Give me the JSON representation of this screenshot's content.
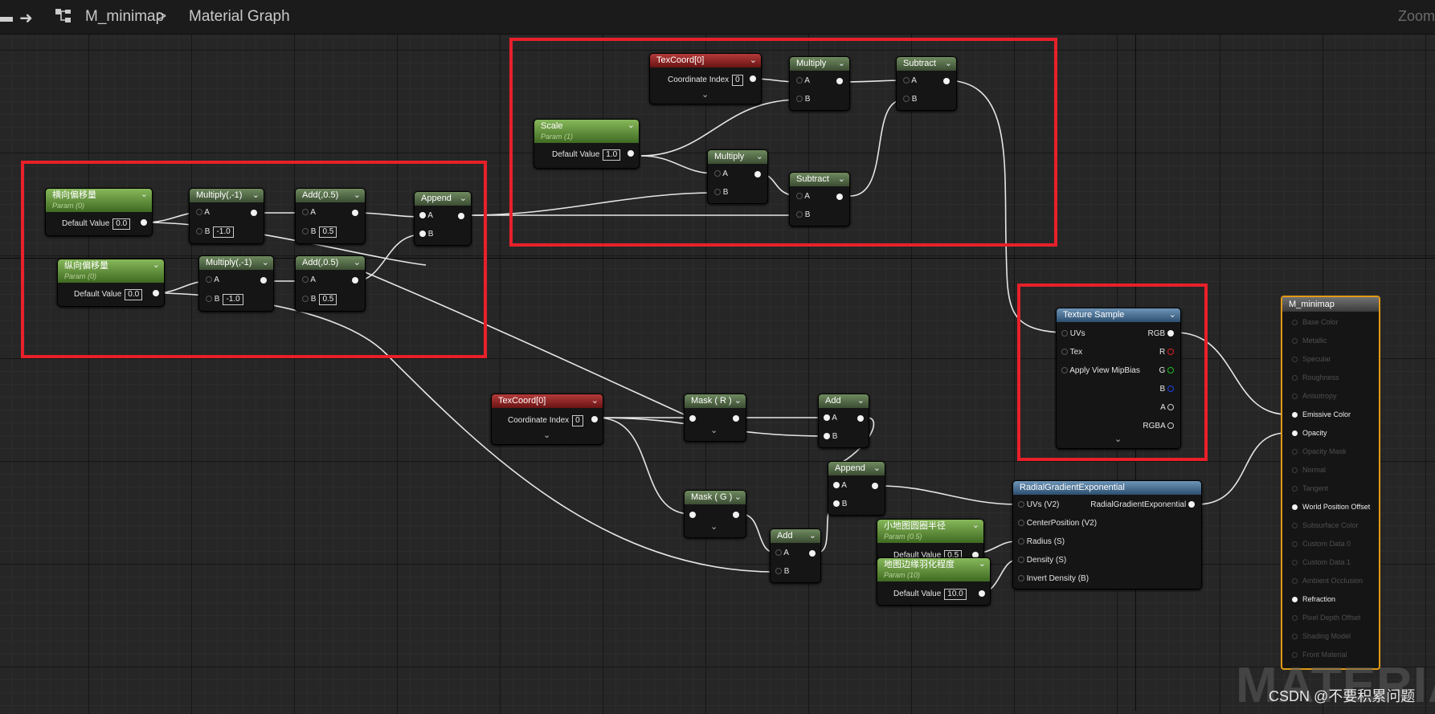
{
  "app": {
    "title": "Material Graph"
  },
  "breadcrumb": {
    "asset": "M_minimap",
    "separator": ">",
    "graph": "Material Graph"
  },
  "toolbar": {
    "zoom_label": "Zoom"
  },
  "nodes": {
    "texcoord_top": {
      "title": "TexCoord[0]",
      "label": "Coordinate Index",
      "value": "0"
    },
    "scale": {
      "title": "Scale",
      "subtitle": "Param (1)",
      "label": "Default Value",
      "value": "1.0"
    },
    "multiply_top1": {
      "title": "Multiply",
      "pin_a": "A",
      "pin_b": "B"
    },
    "multiply_top2": {
      "title": "Multiply",
      "pin_a": "A",
      "pin_b": "B"
    },
    "subtract_top1": {
      "title": "Subtract",
      "pin_a": "A",
      "pin_b": "B"
    },
    "subtract_top2": {
      "title": "Subtract",
      "pin_a": "A",
      "pin_b": "B"
    },
    "param_h": {
      "title": "横向偏移量",
      "subtitle": "Param (0)",
      "label": "Default Value",
      "value": "0.0"
    },
    "param_v": {
      "title": "纵向偏移量",
      "subtitle": "Param (0)",
      "label": "Default Value",
      "value": "0.0"
    },
    "mul_neg1_a": {
      "title": "Multiply(,-1)",
      "pin_a": "A",
      "pin_b": "B",
      "value_b": "-1.0"
    },
    "mul_neg1_b": {
      "title": "Multiply(,-1)",
      "pin_a": "A",
      "pin_b": "B",
      "value_b": "-1.0"
    },
    "add05_a": {
      "title": "Add(,0.5)",
      "pin_a": "A",
      "pin_b": "B",
      "value_b": "0.5"
    },
    "add05_b": {
      "title": "Add(,0.5)",
      "pin_a": "A",
      "pin_b": "B",
      "value_b": "0.5"
    },
    "append_left": {
      "title": "Append",
      "pin_a": "A",
      "pin_b": "B"
    },
    "texcoord_bottom": {
      "title": "TexCoord[0]",
      "label": "Coordinate Index",
      "value": "0"
    },
    "mask_r": {
      "title": "Mask ( R )"
    },
    "mask_g": {
      "title": "Mask ( G )"
    },
    "add_1": {
      "title": "Add",
      "pin_a": "A",
      "pin_b": "B"
    },
    "add_2": {
      "title": "Add",
      "pin_a": "A",
      "pin_b": "B"
    },
    "append_bottom": {
      "title": "Append",
      "pin_a": "A",
      "pin_b": "B"
    },
    "radius_param": {
      "title": "小地图圆圈半径",
      "subtitle": "Param (0.5)",
      "label": "Default Value",
      "value": "0.5"
    },
    "feather_param": {
      "title": "地图边缘羽化程度",
      "subtitle": "Param (10)",
      "label": "Default Value",
      "value": "10.0"
    },
    "texture_sample": {
      "title": "Texture Sample",
      "in_uvs": "UVs",
      "in_tex": "Tex",
      "in_mip": "Apply View MipBias",
      "out_rgb": "RGB",
      "out_r": "R",
      "out_g": "G",
      "out_b": "B",
      "out_a": "A",
      "out_rgba": "RGBA"
    },
    "radial": {
      "title": "RadialGradientExponential",
      "in_uvs": "UVs (V2)",
      "in_center": "CenterPosition (V2)",
      "in_radius": "Radius (S)",
      "in_density": "Density (S)",
      "in_invert": "Invert Density (B)",
      "out": "RadialGradientExponential"
    }
  },
  "material_output": {
    "title": "M_minimap",
    "pins": [
      {
        "label": "Base Color",
        "active": false
      },
      {
        "label": "Metallic",
        "active": false
      },
      {
        "label": "Specular",
        "active": false
      },
      {
        "label": "Roughness",
        "active": false
      },
      {
        "label": "Anisotropy",
        "active": false
      },
      {
        "label": "Emissive Color",
        "active": true
      },
      {
        "label": "Opacity",
        "active": true
      },
      {
        "label": "Opacity Mask",
        "active": false
      },
      {
        "label": "Normal",
        "active": false
      },
      {
        "label": "Tangent",
        "active": false
      },
      {
        "label": "World Position Offset",
        "active": true
      },
      {
        "label": "Subsurface Color",
        "active": false
      },
      {
        "label": "Custom Data 0",
        "active": false
      },
      {
        "label": "Custom Data 1",
        "active": false
      },
      {
        "label": "Ambient Occlusion",
        "active": false
      },
      {
        "label": "Refraction",
        "active": true
      },
      {
        "label": "Pixel Depth Offset",
        "active": false
      },
      {
        "label": "Shading Model",
        "active": false
      },
      {
        "label": "Front Material",
        "active": false
      }
    ]
  },
  "watermark": {
    "big": "MATERIAL",
    "csdn": "CSDN @不要积累问题"
  },
  "colors": {
    "selection": "#e8202a",
    "output_border": "#e39a16",
    "pin_r": "#e02020",
    "pin_g": "#20c020",
    "pin_b": "#2040e0"
  }
}
